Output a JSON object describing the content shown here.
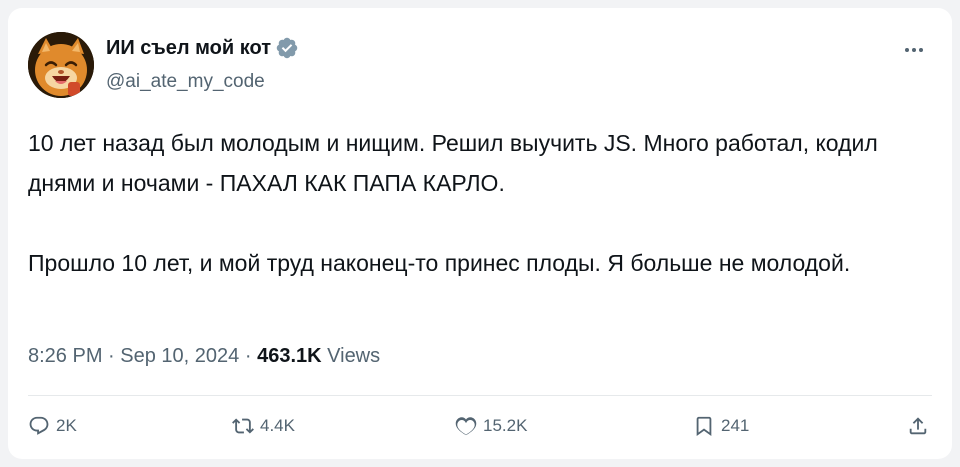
{
  "tweet": {
    "author": {
      "display_name": "ИИ съел мой кот",
      "handle": "@ai_ate_my_code",
      "verified": true,
      "avatar": "cartoon-cat-avatar"
    },
    "paragraphs": [
      "10 лет назад был молодым и нищим. Решил выучить JS. Много работал, кодил днями и ночами - ПАХАЛ КАК ПАПА КАРЛО.",
      "Прошло 10 лет, и мой труд наконец-то принес плоды. Я больше не молодой."
    ],
    "time": "8:26 PM",
    "separator": "·",
    "date": "Sep 10, 2024",
    "views_count": "463.1K",
    "views_label": "Views"
  },
  "actions": {
    "reply_count": "2K",
    "retweet_count": "4.4K",
    "like_count": "15.2K",
    "bookmark_count": "241"
  },
  "icons": {
    "more": "more-horizontal-icon",
    "verified": "verified-badge-icon",
    "reply": "reply-icon",
    "retweet": "retweet-icon",
    "like": "heart-icon",
    "bookmark": "bookmark-icon",
    "share": "share-icon"
  },
  "colors": {
    "text_primary": "#0f1419",
    "text_secondary": "#536471",
    "verified_badge": "#829aab",
    "background": "#ffffff"
  }
}
